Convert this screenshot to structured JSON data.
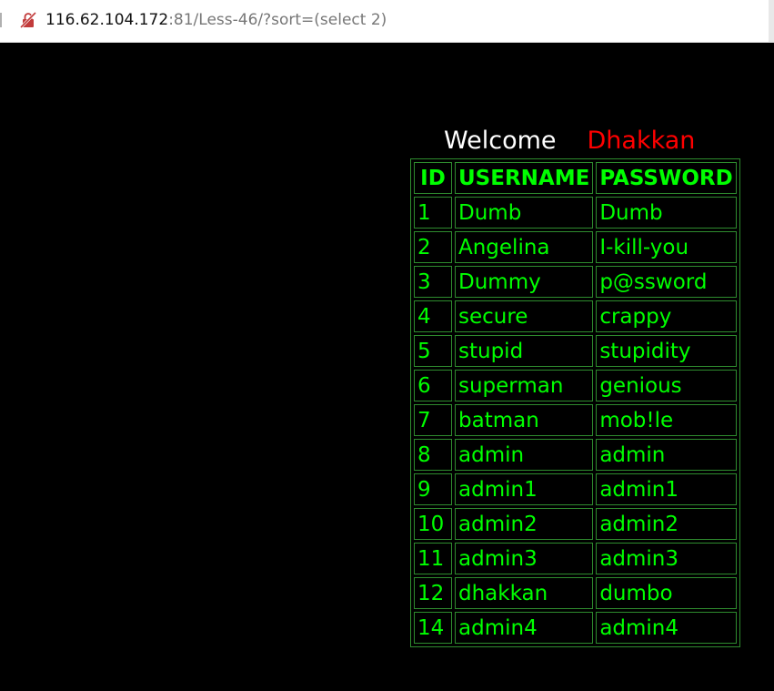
{
  "address_bar": {
    "url_host": "116.62.104.172",
    "url_rest": ":81/Less-46/?sort=(select 2)"
  },
  "welcome": {
    "text": "Welcome",
    "name": "Dhakkan",
    "name_color": "#ff0000"
  },
  "table": {
    "headers": [
      "ID",
      "USERNAME",
      "PASSWORD"
    ],
    "text_color": "#00ff00",
    "rows": [
      {
        "id": "1",
        "username": "Dumb",
        "password": "Dumb"
      },
      {
        "id": "2",
        "username": "Angelina",
        "password": "I-kill-you"
      },
      {
        "id": "3",
        "username": "Dummy",
        "password": "p@ssword"
      },
      {
        "id": "4",
        "username": "secure",
        "password": "crappy"
      },
      {
        "id": "5",
        "username": "stupid",
        "password": "stupidity"
      },
      {
        "id": "6",
        "username": "superman",
        "password": "genious"
      },
      {
        "id": "7",
        "username": "batman",
        "password": "mob!le"
      },
      {
        "id": "8",
        "username": "admin",
        "password": "admin"
      },
      {
        "id": "9",
        "username": "admin1",
        "password": "admin1"
      },
      {
        "id": "10",
        "username": "admin2",
        "password": "admin2"
      },
      {
        "id": "11",
        "username": "admin3",
        "password": "admin3"
      },
      {
        "id": "12",
        "username": "dhakkan",
        "password": "dumbo"
      },
      {
        "id": "14",
        "username": "admin4",
        "password": "admin4"
      }
    ]
  },
  "icons": {
    "not_secure": "not-secure-icon"
  }
}
